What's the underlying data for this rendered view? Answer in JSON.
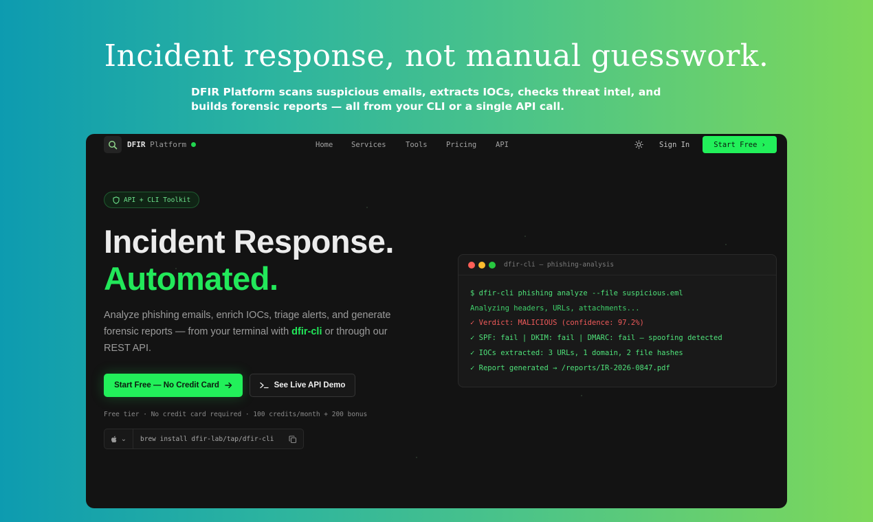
{
  "headline": "Incident response, not manual guesswork.",
  "subhead": "DFIR Platform scans suspicious emails, extracts IOCs, checks threat intel, and builds forensic reports — all from your CLI or a single API call.",
  "nav": {
    "brand_bold": "DFIR",
    "brand_thin": "Platform",
    "links": [
      "Home",
      "Services",
      "Tools",
      "Pricing",
      "API"
    ],
    "sign_in": "Sign In",
    "start_free": "Start Free"
  },
  "hero": {
    "badge": "API + CLI Toolkit",
    "title_line1": "Incident Response.",
    "title_line2": "Automated.",
    "lead_before": "Analyze phishing emails, enrich IOCs, triage alerts, and generate forensic reports — from your terminal with ",
    "lead_highlight": "dfir-cli",
    "lead_after": " or through our REST API.",
    "primary_cta": "Start Free — No Credit Card",
    "secondary_cta": "See Live API Demo",
    "fine_print": "Free tier · No credit card required · 100 credits/month + 200 bonus",
    "install_cmd": "brew install dfir-lab/tap/dfir-cli"
  },
  "terminal": {
    "title": "dfir-cli — phishing-analysis",
    "lines": [
      {
        "text": "$ dfir-cli phishing analyze --file suspicious.eml",
        "color": "#4fe27a"
      },
      {
        "text": "Analyzing headers, URLs, attachments...",
        "color": "#3fcf6a"
      },
      {
        "text": "✓ Verdict: MALICIOUS (confidence: 97.2%)",
        "color": "#ef5a5a"
      },
      {
        "text": "✓ SPF: fail | DKIM: fail | DMARC: fail — spoofing detected",
        "color": "#4fe27a"
      },
      {
        "text": "✓ IOCs extracted: 3 URLs, 1 domain, 2 file hashes",
        "color": "#4fe27a"
      },
      {
        "text": "✓ Report generated → /reports/IR-2026-0847.pdf",
        "color": "#4fe27a"
      }
    ]
  },
  "colors": {
    "accent": "#22f05a",
    "frame_bg": "#131313",
    "gradient_start": "#0d9bb0",
    "gradient_end": "#7dd85a"
  }
}
